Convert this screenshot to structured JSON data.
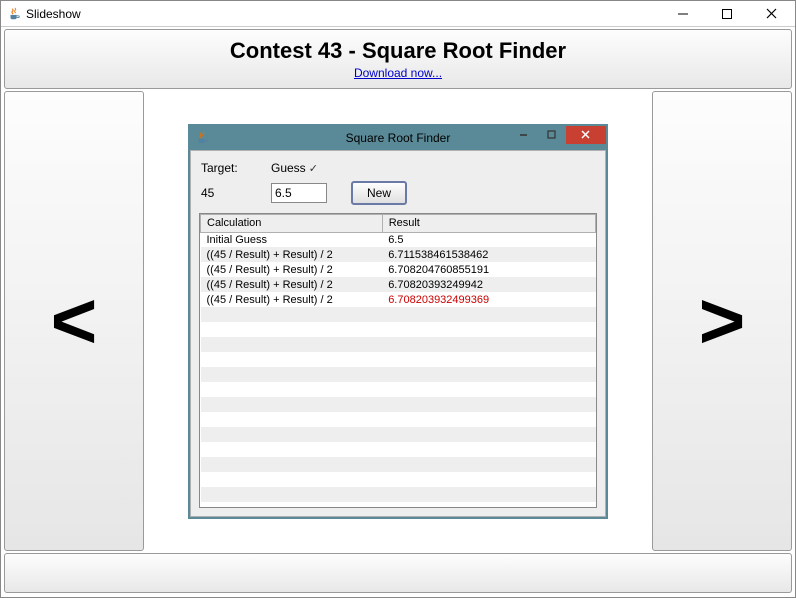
{
  "outer": {
    "title": "Slideshow"
  },
  "header": {
    "title": "Contest 43 - Square Root Finder",
    "link_text": "Download now..."
  },
  "nav": {
    "prev": "<",
    "next": ">"
  },
  "inner": {
    "title": "Square Root Finder",
    "labels": {
      "target": "Target:",
      "guess": "Guess",
      "target_value": "45",
      "guess_value": "6.5",
      "new_button": "New"
    },
    "table": {
      "columns": [
        "Calculation",
        "Result"
      ],
      "rows": [
        {
          "calc": "Initial Guess",
          "result": "6.5",
          "red": false
        },
        {
          "calc": "((45 / Result) + Result) / 2",
          "result": "6.711538461538462",
          "red": false
        },
        {
          "calc": "((45 / Result) + Result) / 2",
          "result": "6.708204760855191",
          "red": false
        },
        {
          "calc": "((45 / Result) + Result) / 2",
          "result": "6.70820393249942",
          "red": false
        },
        {
          "calc": "((45 / Result) + Result) / 2",
          "result": "6.708203932499369",
          "red": true
        }
      ]
    }
  }
}
